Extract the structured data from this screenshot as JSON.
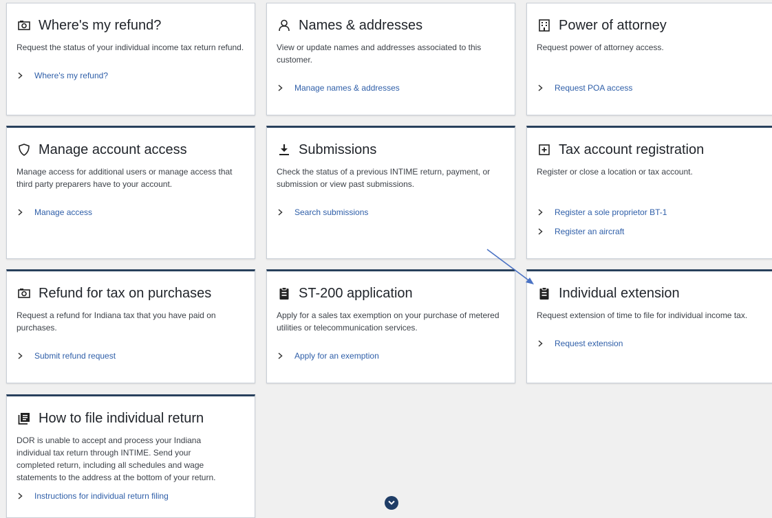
{
  "colors": {
    "page_background": "#f0f0f0",
    "card_background": "#ffffff",
    "card_accent": "#28405c",
    "link": "#2e5ea8",
    "title": "#1f2329",
    "annotation_arrow": "#4a72c4"
  },
  "cards": [
    {
      "icon": "camera-icon",
      "title": "Where's my refund?",
      "description": "Request the status of your individual income tax return refund.",
      "links": [
        "Where's my refund?"
      ]
    },
    {
      "icon": "person-icon",
      "title": "Names & addresses",
      "description": "View or update names and addresses associated to this customer.",
      "links": [
        "Manage names & addresses"
      ]
    },
    {
      "icon": "building-icon",
      "title": "Power of attorney",
      "description": "Request power of attorney access.",
      "links": [
        "Request POA access"
      ]
    },
    {
      "icon": "shield-icon",
      "title": "Manage account access",
      "description": "Manage access for additional users or manage access that third party preparers have to your account.",
      "links": [
        "Manage access"
      ]
    },
    {
      "icon": "download-icon",
      "title": "Submissions",
      "description": "Check the status of a previous INTIME return, payment, or submission or view past submissions.",
      "links": [
        "Search submissions"
      ]
    },
    {
      "icon": "plus-box-icon",
      "title": "Tax account registration",
      "description": "Register or close a location or tax account.",
      "links": [
        "Register a sole proprietor BT-1",
        "Register an aircraft"
      ]
    },
    {
      "icon": "camera-icon",
      "title": "Refund for tax on purchases",
      "description": "Request a refund for Indiana tax that you have paid on purchases.",
      "links": [
        "Submit refund request"
      ]
    },
    {
      "icon": "clipboard-icon",
      "title": "ST-200 application",
      "description": "Apply for a sales tax exemption on your purchase of metered utilities or telecommunication services.",
      "links": [
        "Apply for an exemption"
      ]
    },
    {
      "icon": "clipboard-icon",
      "title": "Individual extension",
      "description": "Request extension of time to file for individual income tax.",
      "links": [
        "Request extension"
      ]
    },
    {
      "icon": "document-list-icon",
      "title": "How to file individual return",
      "description": "DOR is unable to accept and process your Indiana individual tax return through INTIME. Send your completed return, including all schedules and wage statements to the address at the bottom of your return.",
      "links": [
        "Instructions for individual return filing"
      ]
    }
  ],
  "scroll_button": {
    "icon": "chevron-down-icon"
  }
}
